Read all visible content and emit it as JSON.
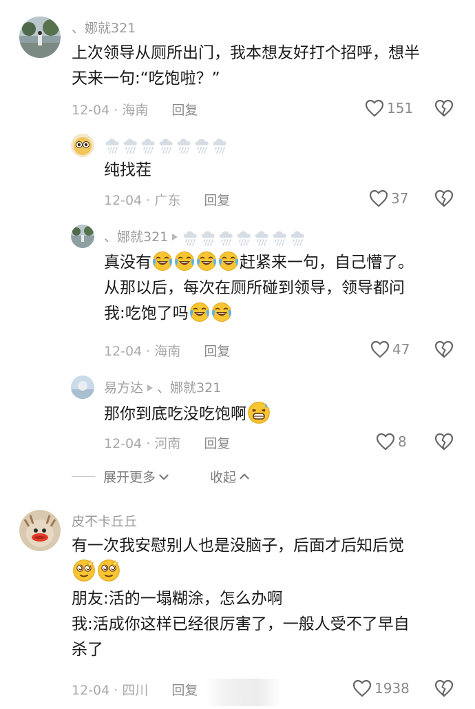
{
  "comments": [
    {
      "user": "、娜就321",
      "lines": [
        "上次领导从厕所出门，我本想友好打个招呼，想半",
        "天来一句:“吃饱啦？”"
      ],
      "date": "12-04",
      "location": "海南",
      "reply": "回复",
      "likes": "151"
    },
    {
      "user": "",
      "text": "纯找茬",
      "date": "12-04",
      "location": "广东",
      "reply": "回复",
      "likes": "37"
    },
    {
      "user": "、娜就321",
      "line1": "真没有",
      "line1b": "赶紧来一句，自己懵了。",
      "line2": "从那以后，每次在厕所碰到领导，领导都问",
      "line3": "我:吃饱了吗",
      "date": "12-04",
      "location": "海南",
      "reply": "回复",
      "likes": "47"
    },
    {
      "user": "易方达",
      "reply_to": "、娜就321",
      "text": "那你到底吃没吃饱啊",
      "date": "12-04",
      "location": "河南",
      "reply": "回复",
      "likes": "8"
    },
    {
      "user": "皮不卡丘丘",
      "line1": "有一次我安慰别人也是没脑子，后面才后知后觉",
      "line3": "朋友:活的一塌糊涂，怎么办啊",
      "line4": "我:活成你这样已经很厉害了，一般人受不了早自",
      "line5": "杀了",
      "date": "12-04",
      "location": "四川",
      "reply": "回复",
      "likes": "1938"
    }
  ],
  "expand": {
    "more": "展开更多",
    "collapse": "收起"
  },
  "icons": {
    "like": "heart-outline-icon",
    "dislike": "broken-heart-icon",
    "chevron_down": "chevron-down-icon",
    "chevron_up": "chevron-up-icon",
    "weather": "rain-cloud-icon",
    "emoji_laugh_cry": "rolling-laughing-emoji",
    "emoji_sweat": "grinning-sweat-emoji",
    "emoji_dizzy": "dizzy-face-emoji"
  },
  "colors": {
    "text": "#1a1a1a",
    "muted": "#a9a9a9",
    "emoji": "#f7c531"
  }
}
